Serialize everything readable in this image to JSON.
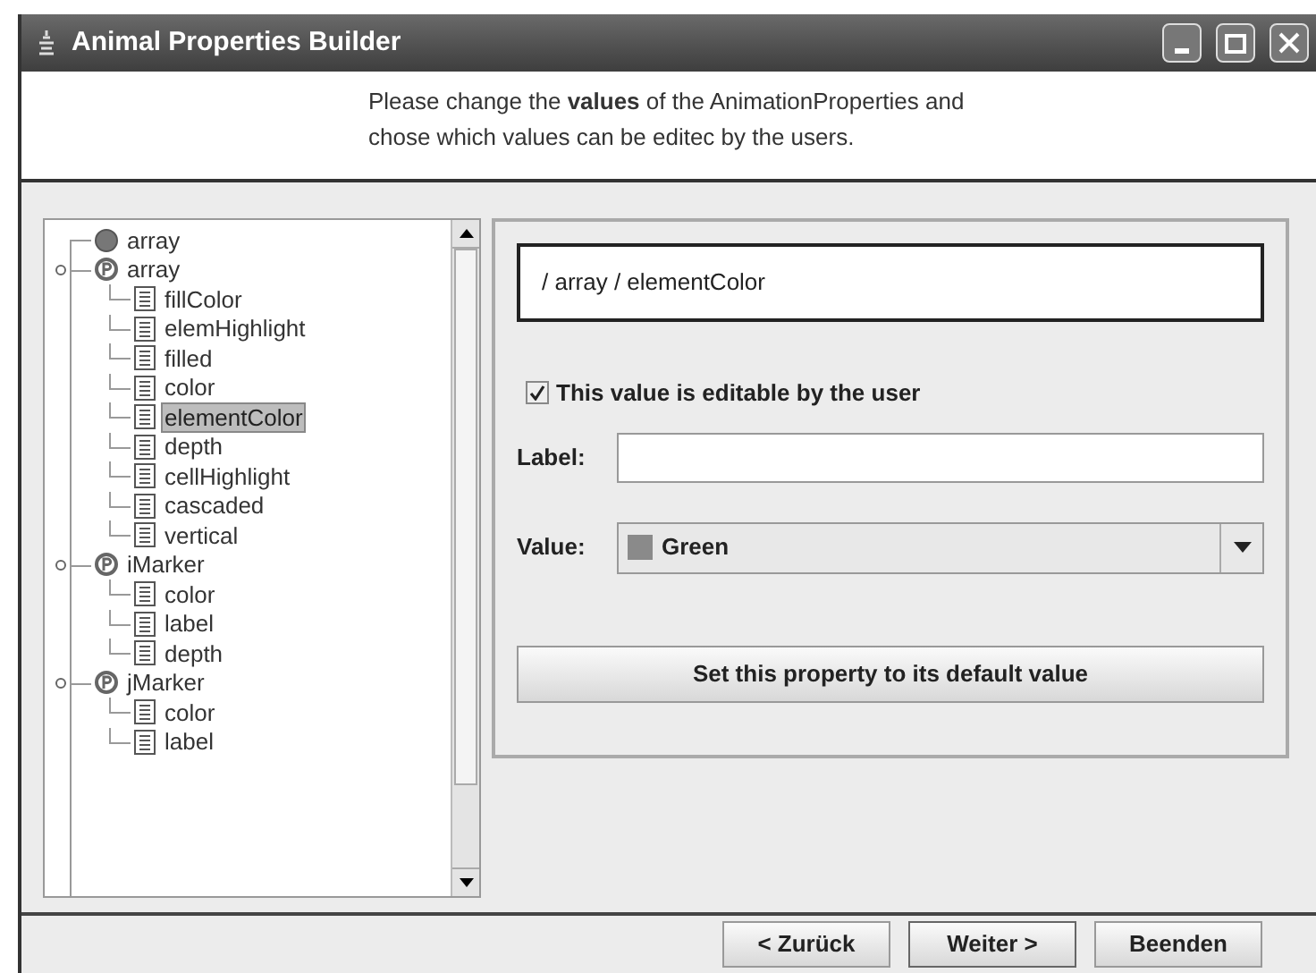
{
  "window": {
    "title": "Animal Properties Builder"
  },
  "instructions": "Please change the **values** of the AnimationProperties and\nchose which values can be editec by the users.",
  "tree": [
    {
      "label": "array",
      "kind": "leaf_node",
      "selected": false
    },
    {
      "label": "array",
      "kind": "group",
      "expanded": true,
      "selected": false,
      "children": [
        {
          "label": "fillColor",
          "kind": "property",
          "selected": false
        },
        {
          "label": "elemHighlight",
          "kind": "property",
          "selected": false
        },
        {
          "label": "filled",
          "kind": "property",
          "selected": false
        },
        {
          "label": "color",
          "kind": "property",
          "selected": false
        },
        {
          "label": "elementColor",
          "kind": "property",
          "selected": true
        },
        {
          "label": "depth",
          "kind": "property",
          "selected": false
        },
        {
          "label": "cellHighlight",
          "kind": "property",
          "selected": false
        },
        {
          "label": "cascaded",
          "kind": "property",
          "selected": false
        },
        {
          "label": "vertical",
          "kind": "property",
          "selected": false
        }
      ]
    },
    {
      "label": "iMarker",
      "kind": "group",
      "expanded": true,
      "selected": false,
      "children": [
        {
          "label": "color",
          "kind": "property",
          "selected": false
        },
        {
          "label": "label",
          "kind": "property",
          "selected": false
        },
        {
          "label": "depth",
          "kind": "property",
          "selected": false
        }
      ]
    },
    {
      "label": "jMarker",
      "kind": "group",
      "expanded": true,
      "selected": false,
      "children": [
        {
          "label": "color",
          "kind": "property",
          "selected": false
        },
        {
          "label": "label",
          "kind": "property",
          "selected": false
        }
      ]
    }
  ],
  "property": {
    "path": "/ array / elementColor",
    "editable_checkbox": {
      "label": "This value is editable by the user",
      "checked": true
    },
    "label_field": {
      "label": "Label:"
    },
    "value_field": {
      "label": "Value:",
      "value": "Green",
      "color": "#8a8a8a"
    },
    "default_button": "Set this property to its default value"
  },
  "buttons": [
    "< Zurück",
    "Weiter >",
    "Beenden"
  ]
}
